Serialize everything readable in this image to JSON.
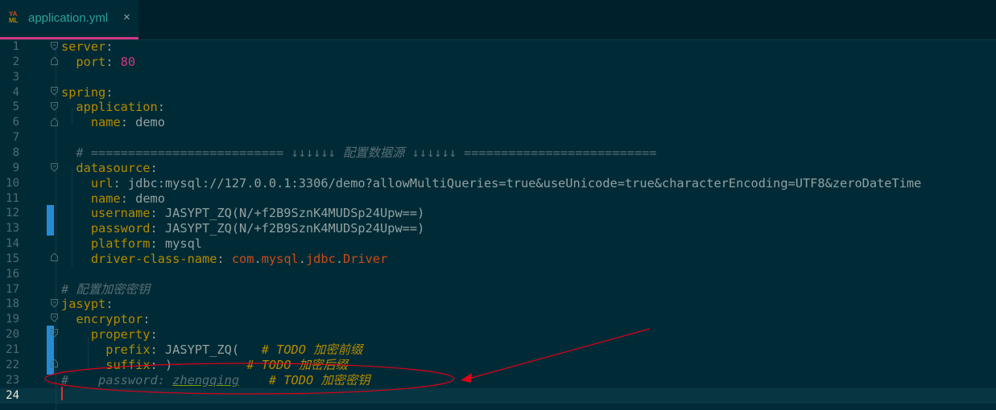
{
  "tab": {
    "icon": "yaml-file-icon",
    "icon_text_top": "YA",
    "icon_text_bottom": "ML",
    "title": "application.yml",
    "close": "×"
  },
  "lines": [
    {
      "n": "1",
      "seg": [
        [
          "k",
          "server"
        ],
        [
          "p",
          ":"
        ]
      ]
    },
    {
      "n": "2",
      "seg": [
        [
          "p",
          "  "
        ],
        [
          "k",
          "port"
        ],
        [
          "p",
          ": "
        ],
        [
          "n",
          "80"
        ]
      ]
    },
    {
      "n": "3",
      "seg": []
    },
    {
      "n": "4",
      "seg": [
        [
          "k",
          "spring"
        ],
        [
          "p",
          ":"
        ]
      ]
    },
    {
      "n": "5",
      "seg": [
        [
          "p",
          "  "
        ],
        [
          "k",
          "application"
        ],
        [
          "p",
          ":"
        ]
      ]
    },
    {
      "n": "6",
      "seg": [
        [
          "p",
          "    "
        ],
        [
          "k",
          "name"
        ],
        [
          "p",
          ": "
        ],
        [
          "v",
          "demo"
        ]
      ]
    },
    {
      "n": "7",
      "seg": []
    },
    {
      "n": "8",
      "seg": [
        [
          "p",
          "  "
        ],
        [
          "c",
          "# ========================== ↓↓↓↓↓↓ 配置数据源 ↓↓↓↓↓↓ =========================="
        ]
      ]
    },
    {
      "n": "9",
      "seg": [
        [
          "p",
          "  "
        ],
        [
          "k",
          "datasource"
        ],
        [
          "p",
          ":"
        ]
      ]
    },
    {
      "n": "10",
      "seg": [
        [
          "p",
          "    "
        ],
        [
          "k",
          "url"
        ],
        [
          "p",
          ": "
        ],
        [
          "v",
          "jdbc:mysql://127.0.0.1:3306/demo?allowMultiQueries=true&useUnicode=true&characterEncoding=UTF8&zeroDateTime"
        ]
      ]
    },
    {
      "n": "11",
      "seg": [
        [
          "p",
          "    "
        ],
        [
          "k",
          "name"
        ],
        [
          "p",
          ": "
        ],
        [
          "v",
          "demo"
        ]
      ]
    },
    {
      "n": "12",
      "seg": [
        [
          "p",
          "    "
        ],
        [
          "k",
          "username"
        ],
        [
          "p",
          ": "
        ],
        [
          "v",
          "JASYPT_ZQ(N/+f2B9SznK4MUDSp24Upw==)"
        ]
      ]
    },
    {
      "n": "13",
      "seg": [
        [
          "p",
          "    "
        ],
        [
          "k",
          "password"
        ],
        [
          "p",
          ": "
        ],
        [
          "v",
          "JASYPT_ZQ(N/+f2B9SznK4MUDSp24Upw==)"
        ]
      ]
    },
    {
      "n": "14",
      "seg": [
        [
          "p",
          "    "
        ],
        [
          "k",
          "platform"
        ],
        [
          "p",
          ": "
        ],
        [
          "v",
          "mysql"
        ]
      ]
    },
    {
      "n": "15",
      "seg": [
        [
          "p",
          "    "
        ],
        [
          "k",
          "driver-class-name"
        ],
        [
          "p",
          ": "
        ],
        [
          "cls",
          "com"
        ],
        [
          "p",
          "."
        ],
        [
          "cls",
          "mysql"
        ],
        [
          "p",
          "."
        ],
        [
          "cls",
          "jdbc"
        ],
        [
          "p",
          "."
        ],
        [
          "cls",
          "Driver"
        ]
      ]
    },
    {
      "n": "16",
      "seg": []
    },
    {
      "n": "17",
      "seg": [
        [
          "c",
          "# 配置加密密钥"
        ]
      ]
    },
    {
      "n": "18",
      "seg": [
        [
          "k",
          "jasypt"
        ],
        [
          "p",
          ":"
        ]
      ]
    },
    {
      "n": "19",
      "seg": [
        [
          "p",
          "  "
        ],
        [
          "k",
          "encryptor"
        ],
        [
          "p",
          ":"
        ]
      ]
    },
    {
      "n": "20",
      "seg": [
        [
          "p",
          "    "
        ],
        [
          "k",
          "property"
        ],
        [
          "p",
          ":"
        ]
      ]
    },
    {
      "n": "21",
      "seg": [
        [
          "p",
          "      "
        ],
        [
          "k",
          "prefix"
        ],
        [
          "p",
          ": "
        ],
        [
          "v",
          "JASYPT_ZQ(   "
        ],
        [
          "t",
          "# TODO 加密前缀"
        ]
      ]
    },
    {
      "n": "22",
      "seg": [
        [
          "p",
          "      "
        ],
        [
          "k",
          "suffix"
        ],
        [
          "p",
          ": "
        ],
        [
          "v",
          ")          "
        ],
        [
          "t",
          "# TODO 加密后缀"
        ]
      ]
    },
    {
      "n": "23",
      "seg": [
        [
          "c",
          "#    password: "
        ],
        [
          "cu",
          "zhengqing"
        ],
        [
          "p",
          "    "
        ],
        [
          "t",
          "# TODO 加密密钥"
        ]
      ]
    },
    {
      "n": "24",
      "seg": []
    }
  ],
  "current_line": "24",
  "colors": {
    "background": "#002b36",
    "key": "#b58900",
    "number": "#d33682",
    "comment": "#586e75",
    "class": "#cb4b16",
    "annotation": "#e0001a"
  }
}
